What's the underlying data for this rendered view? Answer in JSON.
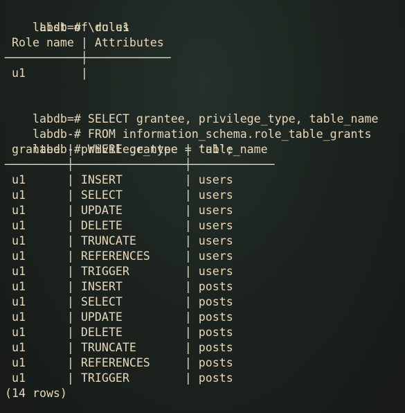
{
  "window": {
    "background": "#1b1f1c",
    "text_color": "#e6d8bb"
  },
  "lines": [
    {
      "type": "prompt",
      "prompt": "labdb=# ",
      "command": "\\du u1"
    },
    {
      "type": "text",
      "text": "     List of roles"
    },
    {
      "type": "text",
      "text": " Role name | Attributes"
    },
    {
      "type": "rule",
      "text": "───────────┼────────────"
    },
    {
      "type": "text",
      "text": " u1        |"
    },
    {
      "type": "blank",
      "text": ""
    },
    {
      "type": "prompt",
      "prompt": "labdb=# ",
      "command": "SELECT grantee, privilege_type, table_name"
    },
    {
      "type": "prompt",
      "prompt": "labdb-# ",
      "command": "FROM information_schema.role_table_grants"
    },
    {
      "type": "prompt",
      "prompt": "labdb-# ",
      "command": "WHERE grantee = 'u1';"
    },
    {
      "type": "text",
      "text": " grantee | privilege_type | table_name"
    },
    {
      "type": "rule",
      "text": "─────────┼────────────────┼────────────"
    },
    {
      "type": "row",
      "text": " u1      | INSERT         | users"
    },
    {
      "type": "row",
      "text": " u1      | SELECT         | users"
    },
    {
      "type": "row",
      "text": " u1      | UPDATE         | users"
    },
    {
      "type": "row",
      "text": " u1      | DELETE         | users"
    },
    {
      "type": "row",
      "text": " u1      | TRUNCATE       | users"
    },
    {
      "type": "row",
      "text": " u1      | REFERENCES     | users"
    },
    {
      "type": "row",
      "text": " u1      | TRIGGER        | users"
    },
    {
      "type": "row",
      "text": " u1      | INSERT         | posts"
    },
    {
      "type": "row",
      "text": " u1      | SELECT         | posts"
    },
    {
      "type": "row",
      "text": " u1      | UPDATE         | posts"
    },
    {
      "type": "row",
      "text": " u1      | DELETE         | posts"
    },
    {
      "type": "row",
      "text": " u1      | TRUNCATE       | posts"
    },
    {
      "type": "row",
      "text": " u1      | REFERENCES     | posts"
    },
    {
      "type": "row",
      "text": " u1      | TRIGGER        | posts"
    },
    {
      "type": "text",
      "text": "(14 rows)"
    }
  ]
}
